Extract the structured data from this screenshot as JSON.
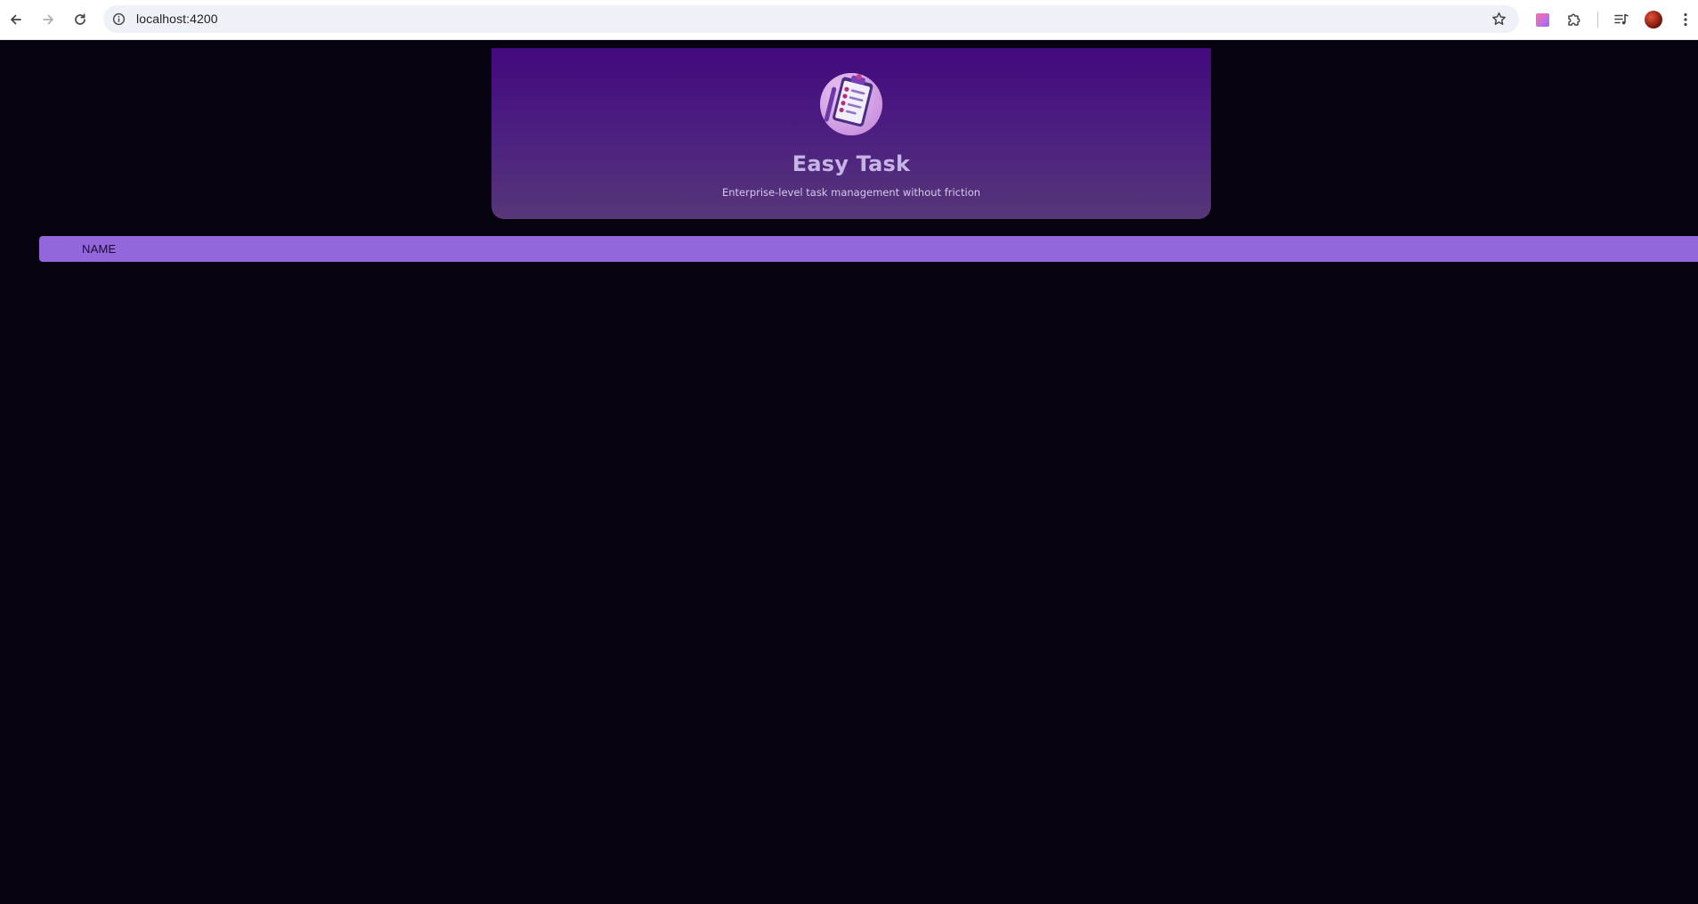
{
  "browser": {
    "url": "localhost:4200",
    "icons": {
      "back": "back-arrow-icon",
      "forward": "forward-arrow-icon",
      "reload": "reload-icon",
      "site_info": "site-info-icon",
      "bookmark": "star-icon",
      "extension": "extension-icon",
      "puzzle": "puzzle-icon",
      "media": "media-controls-icon",
      "profile": "profile-avatar",
      "menu": "kebab-menu-icon"
    }
  },
  "app": {
    "title": "Easy Task",
    "subtitle": "Enterprise-level task management without friction",
    "logo": "clipboard-task-icon",
    "colors": {
      "background": "#07020f",
      "header_top": "#43097e",
      "header_bottom": "#563778",
      "users_bar": "#9466dc",
      "title": "#c7b4e6"
    }
  },
  "users_list": {
    "items": [
      {
        "label": "NAME"
      }
    ]
  }
}
